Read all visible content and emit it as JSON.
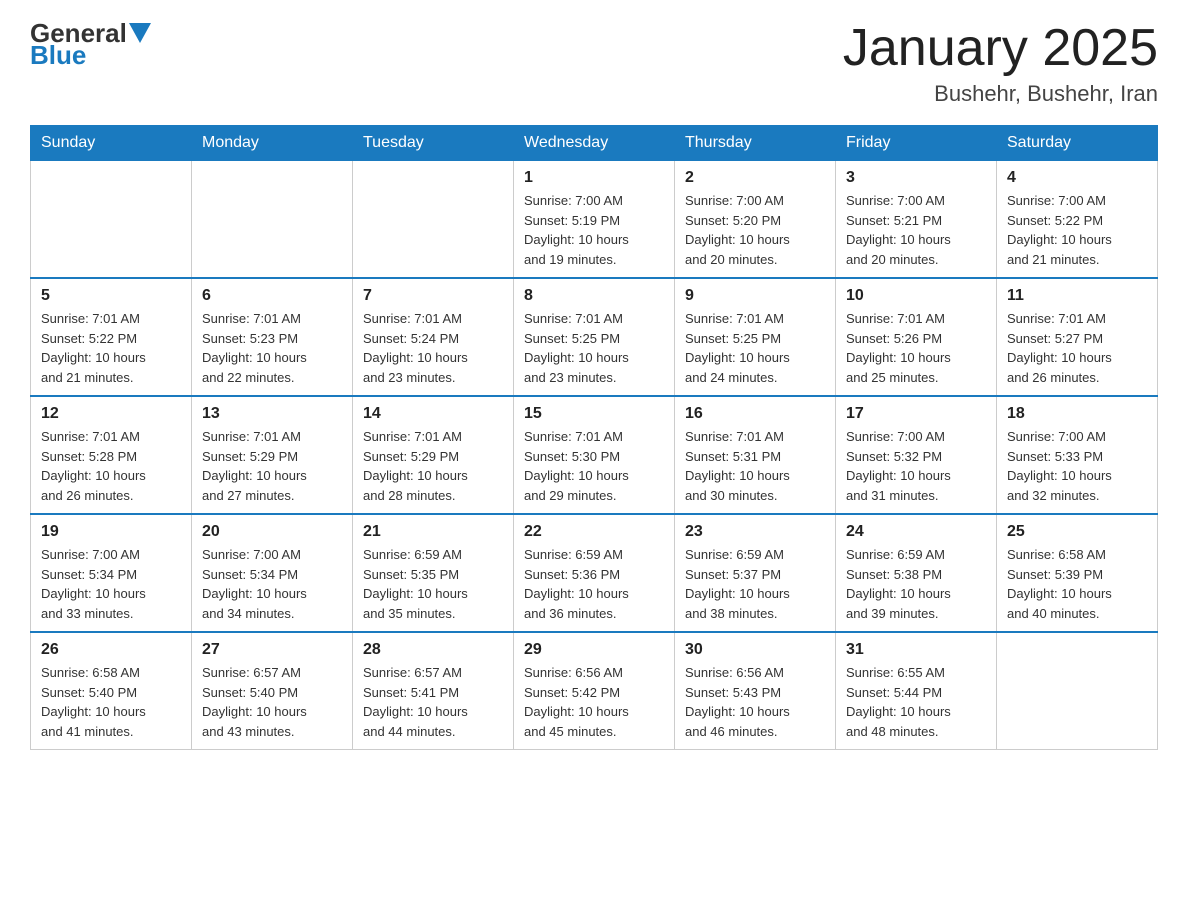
{
  "header": {
    "logo_general": "General",
    "logo_blue": "Blue",
    "month_title": "January 2025",
    "location": "Bushehr, Bushehr, Iran"
  },
  "days_of_week": [
    "Sunday",
    "Monday",
    "Tuesday",
    "Wednesday",
    "Thursday",
    "Friday",
    "Saturday"
  ],
  "weeks": [
    [
      {
        "day": "",
        "info": ""
      },
      {
        "day": "",
        "info": ""
      },
      {
        "day": "",
        "info": ""
      },
      {
        "day": "1",
        "info": "Sunrise: 7:00 AM\nSunset: 5:19 PM\nDaylight: 10 hours\nand 19 minutes."
      },
      {
        "day": "2",
        "info": "Sunrise: 7:00 AM\nSunset: 5:20 PM\nDaylight: 10 hours\nand 20 minutes."
      },
      {
        "day": "3",
        "info": "Sunrise: 7:00 AM\nSunset: 5:21 PM\nDaylight: 10 hours\nand 20 minutes."
      },
      {
        "day": "4",
        "info": "Sunrise: 7:00 AM\nSunset: 5:22 PM\nDaylight: 10 hours\nand 21 minutes."
      }
    ],
    [
      {
        "day": "5",
        "info": "Sunrise: 7:01 AM\nSunset: 5:22 PM\nDaylight: 10 hours\nand 21 minutes."
      },
      {
        "day": "6",
        "info": "Sunrise: 7:01 AM\nSunset: 5:23 PM\nDaylight: 10 hours\nand 22 minutes."
      },
      {
        "day": "7",
        "info": "Sunrise: 7:01 AM\nSunset: 5:24 PM\nDaylight: 10 hours\nand 23 minutes."
      },
      {
        "day": "8",
        "info": "Sunrise: 7:01 AM\nSunset: 5:25 PM\nDaylight: 10 hours\nand 23 minutes."
      },
      {
        "day": "9",
        "info": "Sunrise: 7:01 AM\nSunset: 5:25 PM\nDaylight: 10 hours\nand 24 minutes."
      },
      {
        "day": "10",
        "info": "Sunrise: 7:01 AM\nSunset: 5:26 PM\nDaylight: 10 hours\nand 25 minutes."
      },
      {
        "day": "11",
        "info": "Sunrise: 7:01 AM\nSunset: 5:27 PM\nDaylight: 10 hours\nand 26 minutes."
      }
    ],
    [
      {
        "day": "12",
        "info": "Sunrise: 7:01 AM\nSunset: 5:28 PM\nDaylight: 10 hours\nand 26 minutes."
      },
      {
        "day": "13",
        "info": "Sunrise: 7:01 AM\nSunset: 5:29 PM\nDaylight: 10 hours\nand 27 minutes."
      },
      {
        "day": "14",
        "info": "Sunrise: 7:01 AM\nSunset: 5:29 PM\nDaylight: 10 hours\nand 28 minutes."
      },
      {
        "day": "15",
        "info": "Sunrise: 7:01 AM\nSunset: 5:30 PM\nDaylight: 10 hours\nand 29 minutes."
      },
      {
        "day": "16",
        "info": "Sunrise: 7:01 AM\nSunset: 5:31 PM\nDaylight: 10 hours\nand 30 minutes."
      },
      {
        "day": "17",
        "info": "Sunrise: 7:00 AM\nSunset: 5:32 PM\nDaylight: 10 hours\nand 31 minutes."
      },
      {
        "day": "18",
        "info": "Sunrise: 7:00 AM\nSunset: 5:33 PM\nDaylight: 10 hours\nand 32 minutes."
      }
    ],
    [
      {
        "day": "19",
        "info": "Sunrise: 7:00 AM\nSunset: 5:34 PM\nDaylight: 10 hours\nand 33 minutes."
      },
      {
        "day": "20",
        "info": "Sunrise: 7:00 AM\nSunset: 5:34 PM\nDaylight: 10 hours\nand 34 minutes."
      },
      {
        "day": "21",
        "info": "Sunrise: 6:59 AM\nSunset: 5:35 PM\nDaylight: 10 hours\nand 35 minutes."
      },
      {
        "day": "22",
        "info": "Sunrise: 6:59 AM\nSunset: 5:36 PM\nDaylight: 10 hours\nand 36 minutes."
      },
      {
        "day": "23",
        "info": "Sunrise: 6:59 AM\nSunset: 5:37 PM\nDaylight: 10 hours\nand 38 minutes."
      },
      {
        "day": "24",
        "info": "Sunrise: 6:59 AM\nSunset: 5:38 PM\nDaylight: 10 hours\nand 39 minutes."
      },
      {
        "day": "25",
        "info": "Sunrise: 6:58 AM\nSunset: 5:39 PM\nDaylight: 10 hours\nand 40 minutes."
      }
    ],
    [
      {
        "day": "26",
        "info": "Sunrise: 6:58 AM\nSunset: 5:40 PM\nDaylight: 10 hours\nand 41 minutes."
      },
      {
        "day": "27",
        "info": "Sunrise: 6:57 AM\nSunset: 5:40 PM\nDaylight: 10 hours\nand 43 minutes."
      },
      {
        "day": "28",
        "info": "Sunrise: 6:57 AM\nSunset: 5:41 PM\nDaylight: 10 hours\nand 44 minutes."
      },
      {
        "day": "29",
        "info": "Sunrise: 6:56 AM\nSunset: 5:42 PM\nDaylight: 10 hours\nand 45 minutes."
      },
      {
        "day": "30",
        "info": "Sunrise: 6:56 AM\nSunset: 5:43 PM\nDaylight: 10 hours\nand 46 minutes."
      },
      {
        "day": "31",
        "info": "Sunrise: 6:55 AM\nSunset: 5:44 PM\nDaylight: 10 hours\nand 48 minutes."
      },
      {
        "day": "",
        "info": ""
      }
    ]
  ]
}
